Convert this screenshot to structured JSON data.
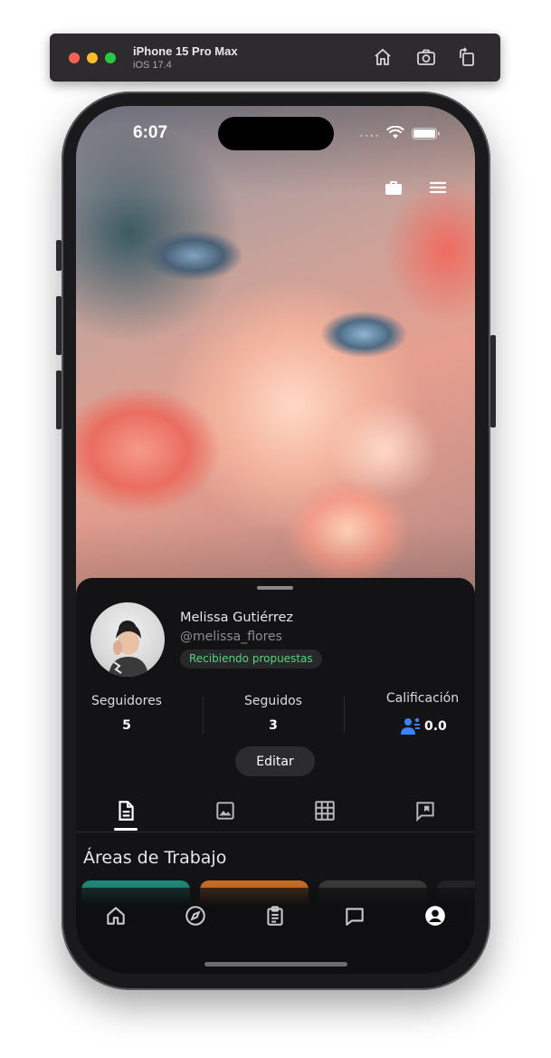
{
  "simulator": {
    "device": "iPhone 15 Pro Max",
    "os": "iOS 17.4",
    "icons": [
      "home-icon",
      "screenshot-icon",
      "rotate-icon"
    ]
  },
  "status_bar": {
    "time": "6:07",
    "icons": [
      "wifi-icon",
      "battery-icon"
    ]
  },
  "header_actions": {
    "icons": [
      "briefcase-icon",
      "menu-icon"
    ]
  },
  "profile": {
    "name": "Melissa Gutiérrez",
    "username": "@melissa_flores",
    "status_badge": "Recibiendo propuestas",
    "status_color": "#5cd07a"
  },
  "stats": {
    "followers_label": "Seguidores",
    "followers_value": "5",
    "following_label": "Seguidos",
    "following_value": "3",
    "rating_label": "Calificación",
    "rating_value": "0.0",
    "rating_icon": "reviewers-icon",
    "rating_icon_color": "#3b82f6"
  },
  "edit_button": "Editar",
  "content_tabs": [
    {
      "icon": "document-icon",
      "active": true
    },
    {
      "icon": "image-icon",
      "active": false
    },
    {
      "icon": "grid-icon",
      "active": false
    },
    {
      "icon": "bookmark-chat-icon",
      "active": false
    }
  ],
  "section": {
    "title": "Áreas de Trabajo"
  },
  "bottom_nav": [
    {
      "icon": "home-icon"
    },
    {
      "icon": "compass-icon"
    },
    {
      "icon": "clipboard-icon"
    },
    {
      "icon": "chat-icon"
    },
    {
      "icon": "profile-icon",
      "active": true
    }
  ]
}
